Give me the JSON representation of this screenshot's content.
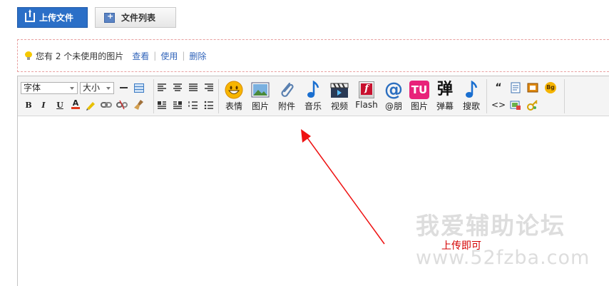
{
  "top_buttons": {
    "upload_label": "上传文件",
    "file_list_label": "文件列表"
  },
  "notice": {
    "text": "您有 2 个未使用的图片",
    "view": "查看",
    "use": "使用",
    "delete": "删除"
  },
  "toolbar": {
    "font_select": "字体",
    "size_select": "大小",
    "format_buttons": [
      "B",
      "I",
      "U",
      "A"
    ],
    "big_buttons": [
      {
        "label": "表情",
        "icon": "smiley-icon"
      },
      {
        "label": "图片",
        "icon": "image-icon"
      },
      {
        "label": "附件",
        "icon": "paperclip-icon"
      },
      {
        "label": "音乐",
        "icon": "music-note-icon"
      },
      {
        "label": "视频",
        "icon": "clapperboard-icon"
      },
      {
        "label": "Flash",
        "icon": "flash-icon"
      },
      {
        "label": "@朋",
        "icon": "at-icon"
      },
      {
        "label": "图片",
        "icon": "tu-icon"
      },
      {
        "label": "弹幕",
        "icon": "danmu-icon"
      },
      {
        "label": "搜歌",
        "icon": "music-search-icon"
      }
    ],
    "tu_glyph": "TU",
    "danmu_glyph": "弹",
    "at_glyph": "@",
    "flash_glyph": "f",
    "quote_glyph": "“",
    "bg_glyph": "Bg",
    "code_glyph": "<>"
  },
  "annotation": "上传即可",
  "watermark": {
    "line1": "我爱辅助论坛",
    "line2": "www.52fzba.com"
  },
  "colors": {
    "primary_button": "#2b6fc7",
    "link": "#3366bb",
    "annotation": "#d40000",
    "arrow": "#ee1111"
  }
}
